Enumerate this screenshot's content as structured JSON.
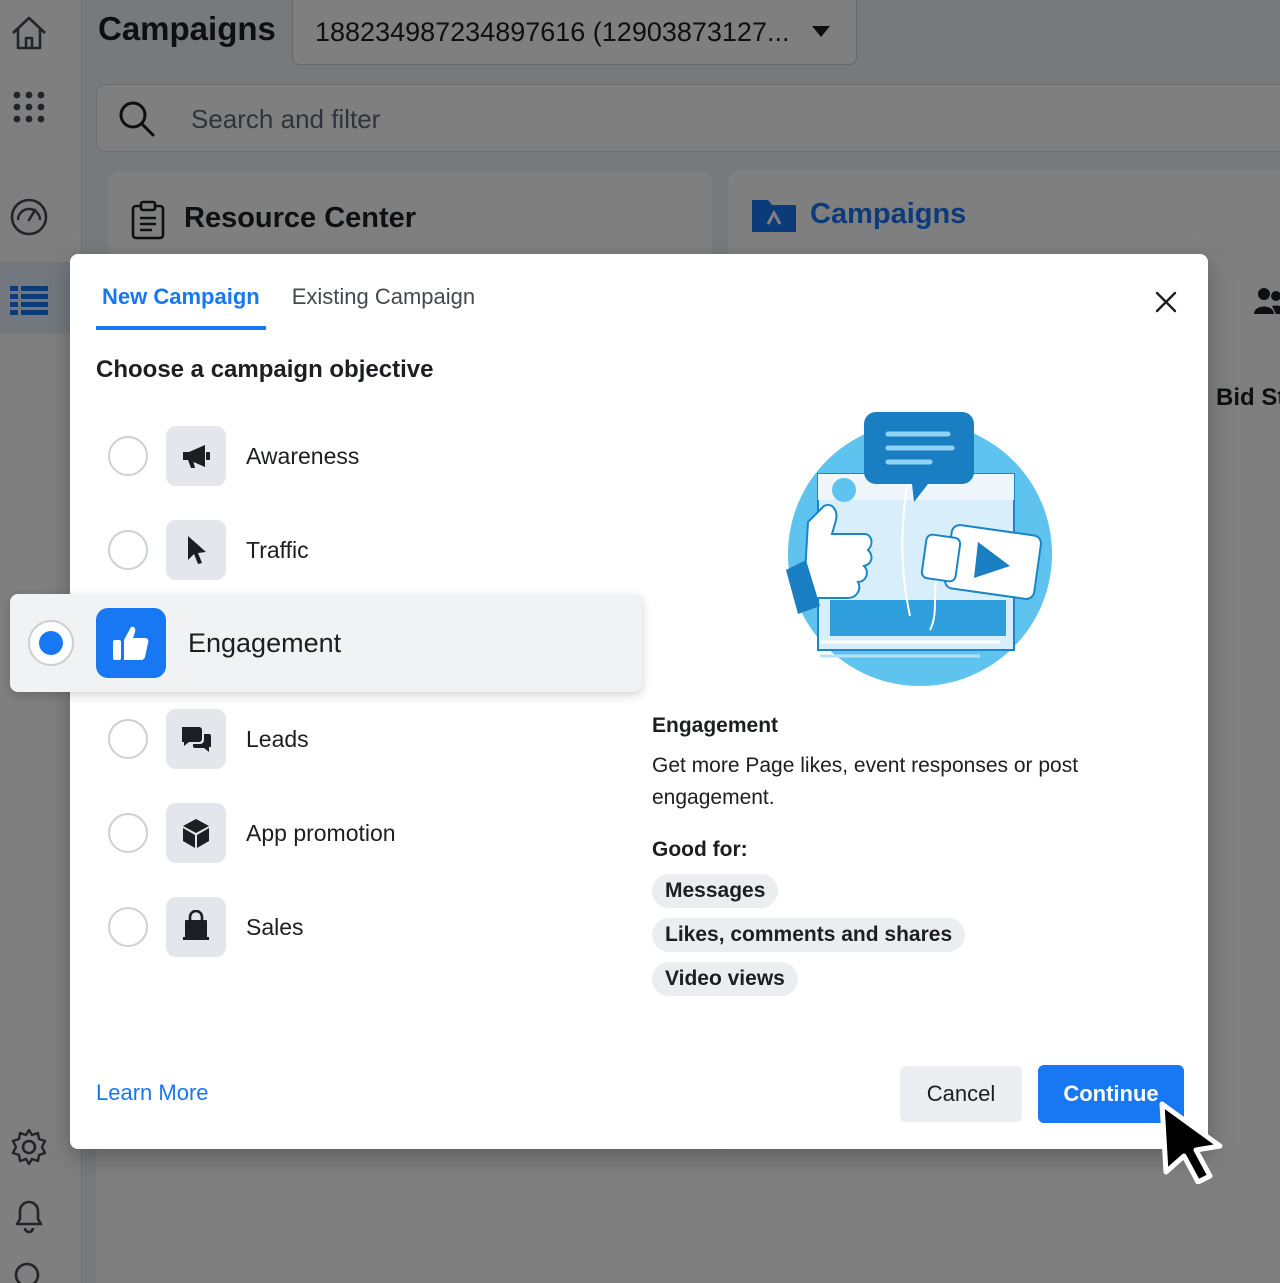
{
  "header": {
    "page_title": "Campaigns",
    "account_selector_value": "188234987234897616 (12903873127..."
  },
  "search": {
    "placeholder": "Search and filter"
  },
  "background_cards": {
    "resource_center_title": "Resource Center",
    "campaigns_title": "Campaigns",
    "table_header_partial": "Bid St"
  },
  "modal": {
    "tabs": [
      {
        "label": "New Campaign",
        "active": true
      },
      {
        "label": "Existing Campaign",
        "active": false
      }
    ],
    "heading": "Choose a campaign objective",
    "objectives": [
      {
        "label": "Awareness",
        "icon": "megaphone-icon",
        "selected": false
      },
      {
        "label": "Traffic",
        "icon": "pointer-icon",
        "selected": false
      },
      {
        "label": "Engagement",
        "icon": "thumbs-up-icon",
        "selected": true
      },
      {
        "label": "Leads",
        "icon": "chat-bubbles-icon",
        "selected": false
      },
      {
        "label": "App promotion",
        "icon": "box-icon",
        "selected": false
      },
      {
        "label": "Sales",
        "icon": "shopping-bag-icon",
        "selected": false
      }
    ],
    "detail": {
      "title": "Engagement",
      "description": "Get more Page likes, event responses or post engagement.",
      "good_for_label": "Good for:",
      "good_for": [
        "Messages",
        "Likes, comments and shares",
        "Video views"
      ]
    },
    "footer": {
      "learn_more": "Learn More",
      "cancel": "Cancel",
      "continue": "Continue"
    }
  },
  "colors": {
    "accent": "#1877f2",
    "chip_bg": "#ebedf0",
    "icon_tile_bg": "#e4e6eb"
  }
}
